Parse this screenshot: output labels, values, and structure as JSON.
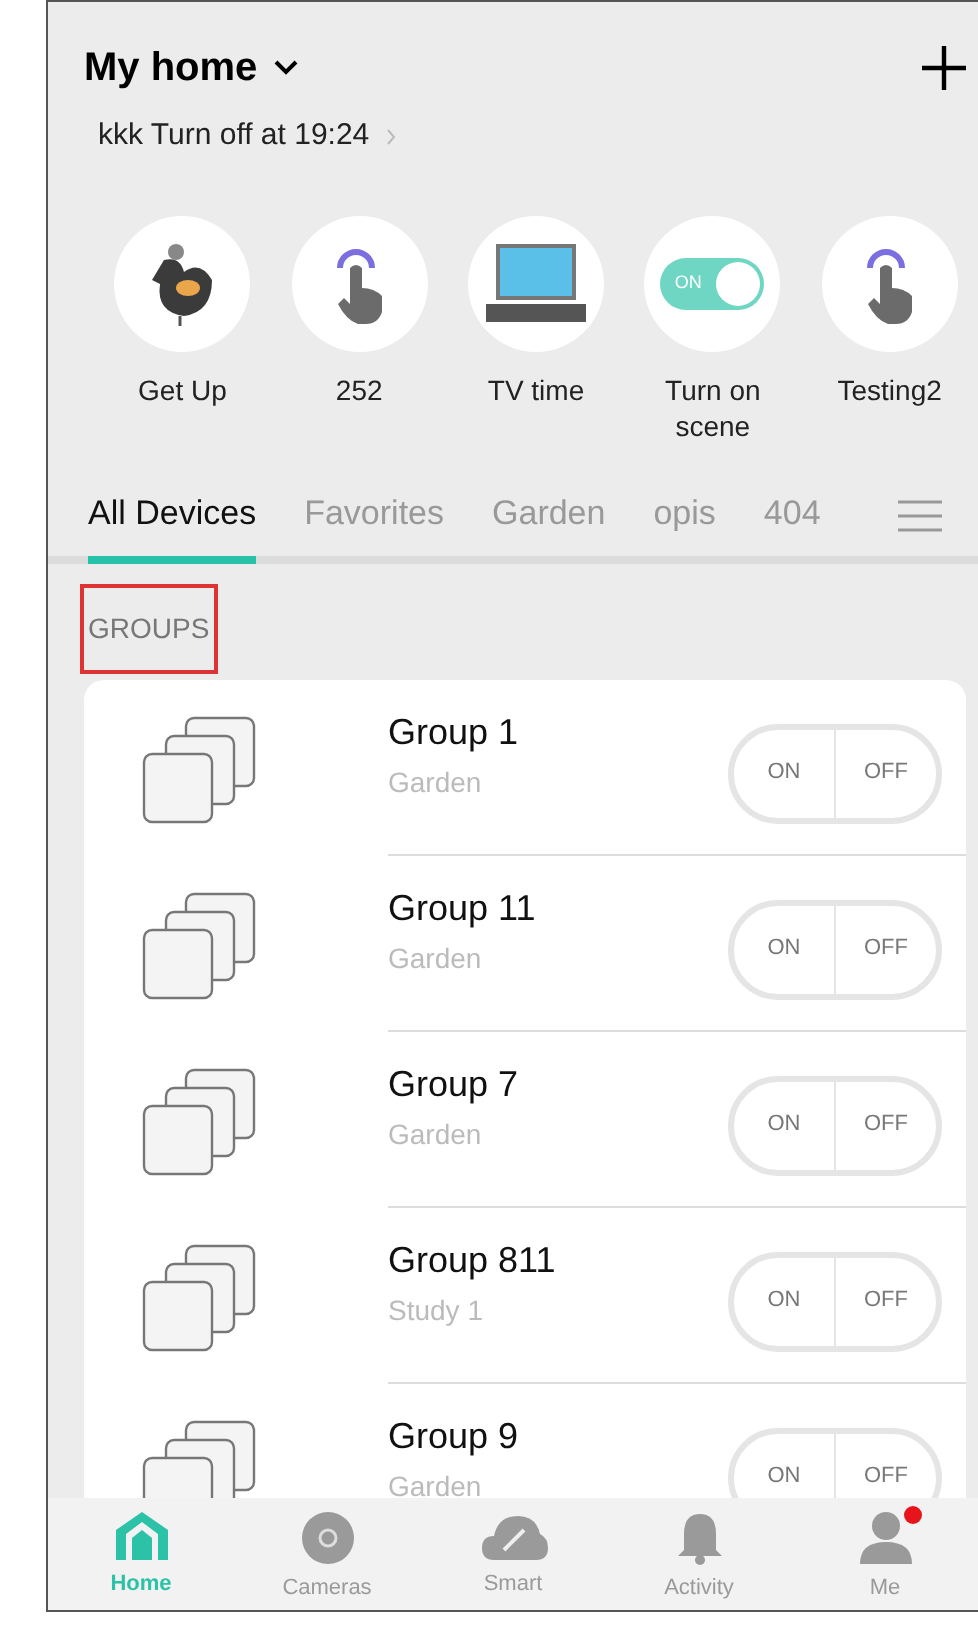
{
  "header": {
    "title": "My home",
    "subtitle": "kkk Turn off at 19:24"
  },
  "scenes": [
    {
      "label": "Get Up",
      "kind": "hen"
    },
    {
      "label": "252",
      "kind": "hand"
    },
    {
      "label": "TV time",
      "kind": "tv"
    },
    {
      "label": "Turn on scene",
      "kind": "toggle",
      "toggle_text": "ON",
      "on": true
    },
    {
      "label": "Testing2",
      "kind": "hand"
    }
  ],
  "tabs": [
    {
      "label": "All Devices",
      "selected": true
    },
    {
      "label": "Favorites",
      "selected": false
    },
    {
      "label": "Garden",
      "selected": false
    },
    {
      "label": "opis",
      "selected": false
    },
    {
      "label": "404",
      "selected": false
    }
  ],
  "section": {
    "label": "GROUPS",
    "highlighted": true
  },
  "groups": [
    {
      "name": "Group 1",
      "room": "Garden",
      "buttons": [
        {
          "label": "ON",
          "selected": false
        },
        {
          "label": "OFF",
          "selected": false
        }
      ]
    },
    {
      "name": "Group 11",
      "room": "Garden",
      "buttons": [
        {
          "label": "ON",
          "selected": false
        },
        {
          "label": "OFF",
          "selected": false
        }
      ]
    },
    {
      "name": "Group 7",
      "room": "Garden",
      "buttons": [
        {
          "label": "ON",
          "selected": false
        },
        {
          "label": "OFF",
          "selected": false
        }
      ]
    },
    {
      "name": "Group 811",
      "room": "Study 1",
      "buttons": [
        {
          "label": "ON",
          "selected": false
        },
        {
          "label": "OFF",
          "selected": false
        }
      ]
    },
    {
      "name": "Group 9",
      "room": "Garden",
      "buttons": [
        {
          "label": "ON",
          "selected": false
        },
        {
          "label": "OFF",
          "selected": false
        }
      ]
    }
  ],
  "nav": [
    {
      "label": "Home",
      "kind": "home",
      "selected": true,
      "notification": false
    },
    {
      "label": "Cameras",
      "kind": "camera",
      "selected": false,
      "notification": false
    },
    {
      "label": "Smart",
      "kind": "smart",
      "selected": false,
      "notification": false
    },
    {
      "label": "Activity",
      "kind": "bell",
      "selected": false,
      "notification": false
    },
    {
      "label": "Me",
      "kind": "person",
      "selected": false,
      "notification": true
    }
  ]
}
